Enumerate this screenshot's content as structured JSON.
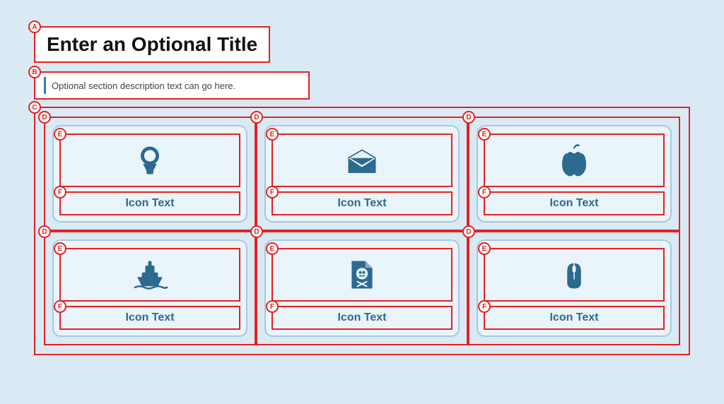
{
  "page": {
    "background": "#daeaf5"
  },
  "header": {
    "title": "Enter an Optional Title",
    "description": "Optional section description text can go here."
  },
  "labels": {
    "A": "A",
    "B": "B",
    "C": "C",
    "D": "D",
    "E": "E",
    "F": "F"
  },
  "cards": [
    {
      "icon": "award",
      "text": "Icon Text"
    },
    {
      "icon": "envelope",
      "text": "Icon Text"
    },
    {
      "icon": "apple",
      "text": "Icon Text"
    },
    {
      "icon": "ship",
      "text": "Icon Text"
    },
    {
      "icon": "skull",
      "text": "Icon Text"
    },
    {
      "icon": "mouse",
      "text": "Icon Text"
    }
  ]
}
